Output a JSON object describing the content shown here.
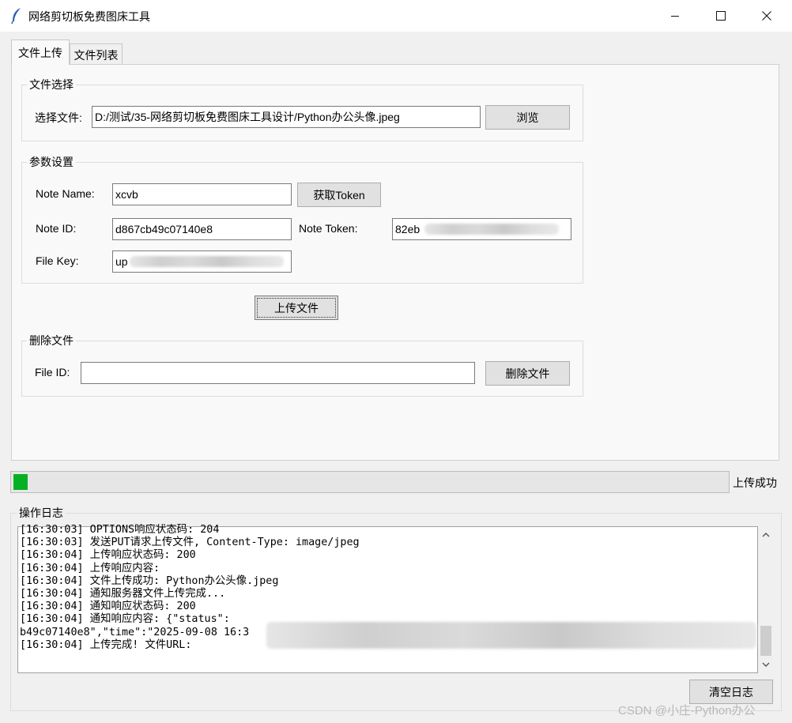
{
  "window": {
    "title": "网络剪切板免费图床工具"
  },
  "tabs": [
    {
      "label": "文件上传",
      "active": true
    },
    {
      "label": "文件列表",
      "active": false
    }
  ],
  "file_select": {
    "group_title": "文件选择",
    "label": "选择文件:",
    "path_value": "D:/测试/35-网络剪切板免费图床工具设计/Python办公头像.jpeg",
    "browse_label": "浏览"
  },
  "params": {
    "group_title": "参数设置",
    "note_name_label": "Note Name:",
    "note_name_value": "xcvb",
    "get_token_label": "获取Token",
    "note_id_label": "Note ID:",
    "note_id_value": "d867cb49c07140e8",
    "note_token_label": "Note Token:",
    "note_token_value": "82eb",
    "file_key_label": "File Key:",
    "file_key_value": "up"
  },
  "upload_button_label": "上传文件",
  "delete": {
    "group_title": "删除文件",
    "file_id_label": "File ID:",
    "file_id_value": "",
    "delete_label": "删除文件"
  },
  "progress": {
    "fraction": 0.02,
    "status": "上传成功",
    "fill_color": "#06b025"
  },
  "log": {
    "group_title": "操作日志",
    "lines": [
      "[16:30:03] OPTIONS响应状态码: 204",
      "[16:30:03] 发送PUT请求上传文件, Content-Type: image/jpeg",
      "[16:30:04] 上传响应状态码: 200",
      "[16:30:04] 上传响应内容:",
      "[16:30:04] 文件上传成功: Python办公头像.jpeg",
      "[16:30:04] 通知服务器文件上传完成...",
      "[16:30:04] 通知响应状态码: 200",
      "[16:30:04] 通知响应内容: {\"status\":",
      "b49c07140e8\",\"time\":\"2025-09-08 16:3",
      "[16:30:04] 上传完成! 文件URL:"
    ],
    "clear_label": "清空日志"
  },
  "watermark": "CSDN @小庄-Python办公",
  "icons": {
    "app": "feather-icon",
    "minimize": "minimize-icon",
    "maximize": "maximize-icon",
    "close": "close-icon",
    "scroll_up": "chevron-up-icon",
    "scroll_down": "chevron-down-icon"
  }
}
